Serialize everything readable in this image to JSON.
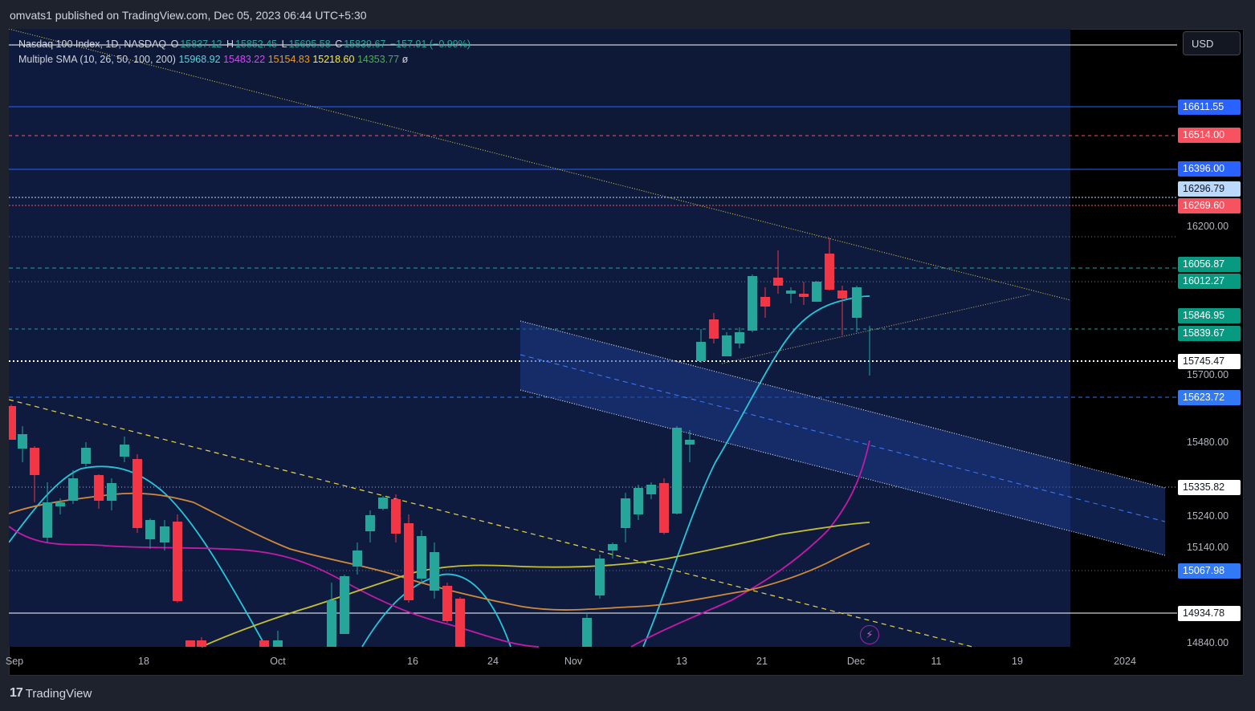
{
  "header": {
    "publisher_text": "omvats1 published on TradingView.com, Dec 05, 2023 06:44 UTC+5:30"
  },
  "legend": {
    "symbol_line": "Nasdaq 100 Index, 1D, NASDAQ",
    "open_label": "O",
    "open_value": "15837.12",
    "high_label": "H",
    "high_value": "15852.45",
    "low_label": "L",
    "low_value": "15695.58",
    "close_label": "C",
    "close_value": "15839.67",
    "change": "−157.91 (−0.99%)",
    "indicator_name": "Multiple SMA (10, 26, 50, 100, 200)",
    "sma_values": [
      {
        "value": "15968.92",
        "color": "#5ad6e0"
      },
      {
        "value": "15483.22",
        "color": "#e040fb"
      },
      {
        "value": "15154.83",
        "color": "#ff9800"
      },
      {
        "value": "15218.60",
        "color": "#ffeb3b"
      },
      {
        "value": "14353.77",
        "color": "#4caf50"
      }
    ],
    "visibility_glyph": "ø"
  },
  "currency_button": "USD",
  "price_scale": {
    "ticks": [
      "16200.00",
      "15700.00",
      "15480.00",
      "15240.00",
      "15140.00",
      "14840.00"
    ],
    "tags": [
      {
        "label": "16611.55",
        "bg": "#2962ff",
        "fg": "#ffffff"
      },
      {
        "label": "16514.00",
        "bg": "#f7525f",
        "fg": "#ffffff"
      },
      {
        "label": "16396.00",
        "bg": "#2962ff",
        "fg": "#ffffff"
      },
      {
        "label": "16296.79",
        "bg": "#bbd9fb",
        "fg": "#131722"
      },
      {
        "label": "16269.60",
        "bg": "#f7525f",
        "fg": "#ffffff"
      },
      {
        "label": "16056.87",
        "bg": "#089981",
        "fg": "#ffffff"
      },
      {
        "label": "16012.27",
        "bg": "#089981",
        "fg": "#ffffff"
      },
      {
        "label": "15846.95",
        "bg": "#089981",
        "fg": "#ffffff"
      },
      {
        "label": "15839.67",
        "bg": "#089981",
        "fg": "#ffffff"
      },
      {
        "label": "15745.47",
        "bg": "#ffffff",
        "fg": "#131722"
      },
      {
        "label": "15623.72",
        "bg": "#3179f5",
        "fg": "#ffffff"
      },
      {
        "label": "15335.82",
        "bg": "#ffffff",
        "fg": "#131722"
      },
      {
        "label": "15067.98",
        "bg": "#3179f5",
        "fg": "#ffffff"
      },
      {
        "label": "14934.78",
        "bg": "#ffffff",
        "fg": "#131722"
      }
    ]
  },
  "time_scale": {
    "ticks": [
      "Sep",
      "18",
      "Oct",
      "16",
      "24",
      "Nov",
      "13",
      "21",
      "Dec",
      "11",
      "19",
      "2024"
    ]
  },
  "footer": {
    "brand_mark": "17",
    "brand_name": "TradingView"
  },
  "colors": {
    "up_candle": "#26a69a",
    "down_candle": "#f23645",
    "background": "#000000",
    "channel_fill": "#1a2a6c"
  },
  "icons": {
    "lightning": "lightning-icon",
    "logo": "tradingview-logo-icon"
  }
}
